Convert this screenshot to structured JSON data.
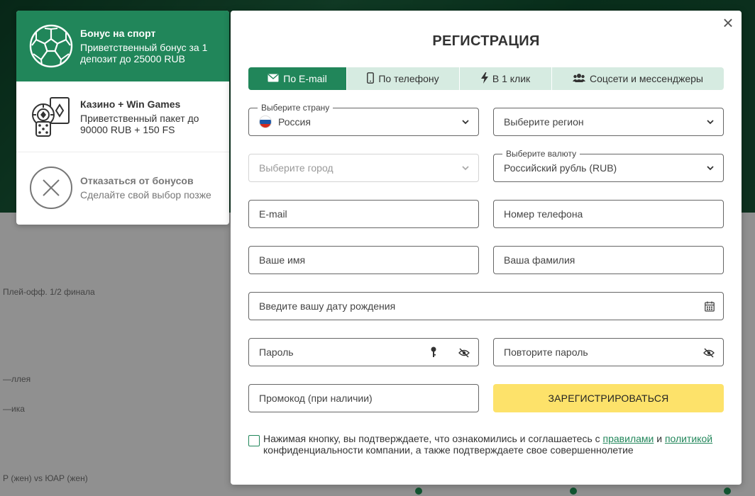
{
  "colors": {
    "accent": "#21865a",
    "submit": "#fde26a",
    "tab_bg": "#d6ebe1"
  },
  "background": {
    "row1": "Плей-офф. 1/2 финала",
    "row2": "—ллея",
    "row3": "—ика",
    "row4": "Р (жен) vs ЮАР (жен)"
  },
  "bonuses": {
    "sport": {
      "icon": "soccer-ball-icon",
      "title": "Бонус на спорт",
      "desc": "Приветственный бонус за 1 депозит до 25000 RUB"
    },
    "casino": {
      "icon": "casino-chips-dice-icon",
      "title": "Казино + Win Games",
      "desc": "Приветственный пакет до 90000 RUB + 150 FS"
    },
    "decline": {
      "icon": "close-circle-icon",
      "title": "Отказаться от бонусов",
      "desc": "Сделайте свой выбор позже"
    }
  },
  "modal": {
    "close": "×",
    "title": "РЕГИСТРАЦИЯ",
    "tabs": [
      {
        "label": "По E-mail",
        "icon": "envelope-icon",
        "active": true
      },
      {
        "label": "По телефону",
        "icon": "phone-icon"
      },
      {
        "label": "В 1 клик",
        "icon": "lightning-icon"
      },
      {
        "label": "Соцсети и мессенджеры",
        "icon": "users-icon"
      }
    ],
    "country": {
      "label": "Выберите страну",
      "value": "Россия"
    },
    "region": {
      "placeholder": "Выберите регион"
    },
    "city": {
      "placeholder": "Выберите город"
    },
    "currency": {
      "label": "Выберите валюту",
      "value": "Российский рубль (RUB)"
    },
    "email": {
      "placeholder": "E-mail"
    },
    "phone": {
      "placeholder": "Номер телефона"
    },
    "first_name": {
      "placeholder": "Ваше имя"
    },
    "last_name": {
      "placeholder": "Ваша фамилия"
    },
    "birth_date": {
      "placeholder": "Введите вашу дату рождения"
    },
    "password": {
      "placeholder": "Пароль"
    },
    "password_repeat": {
      "placeholder": "Повторите пароль"
    },
    "promo": {
      "placeholder": "Промокод (при наличии)"
    },
    "submit": "ЗАРЕГИСТРИРОВАТЬСЯ",
    "consent": {
      "before": "Нажимая кнопку, вы подтверждаете, что ознакомились и соглашаетесь с ",
      "link1": "правилами",
      "middle": " и ",
      "link2": "политикой",
      "after": " конфиденциальности компании, а также подтверждаете свое совершеннолетие"
    }
  }
}
